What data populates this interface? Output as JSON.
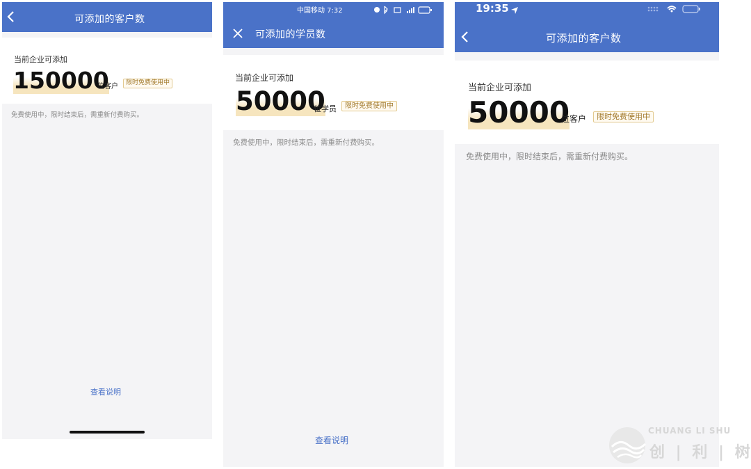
{
  "colors": {
    "header_blue": "#4a72c8",
    "badge_gold": "#a37b2e",
    "link_blue": "#4a72c8"
  },
  "panel1": {
    "back_icon": "chevron-left-icon",
    "title": "可添加的客户数",
    "label": "当前企业可添加",
    "count": "150000",
    "unit": "位客户",
    "badge": "限时免费使用中",
    "note": "免费使用中，限时结束后，需重新付费购买。",
    "link": "查看说明"
  },
  "panel2": {
    "status": {
      "carrier_time": "中国移动 7:32"
    },
    "close_icon": "close-icon",
    "title": "可添加的学员数",
    "label": "当前企业可添加",
    "count": "50000",
    "unit": "位学员",
    "badge": "限时免费使用中",
    "note": "免费使用中，限时结束后，需重新付费购买。",
    "link": "查看说明"
  },
  "panel3": {
    "status": {
      "time": "19:35"
    },
    "back_icon": "chevron-left-icon",
    "title": "可添加的客户数",
    "label": "当前企业可添加",
    "count": "50000",
    "unit": "位客户",
    "badge": "限时免费使用中",
    "note": "免费使用中，限时结束后，需重新付费购买。"
  },
  "watermark": {
    "line1": "CHUANG LI SHU",
    "line2": "创 | 利 | 树"
  }
}
